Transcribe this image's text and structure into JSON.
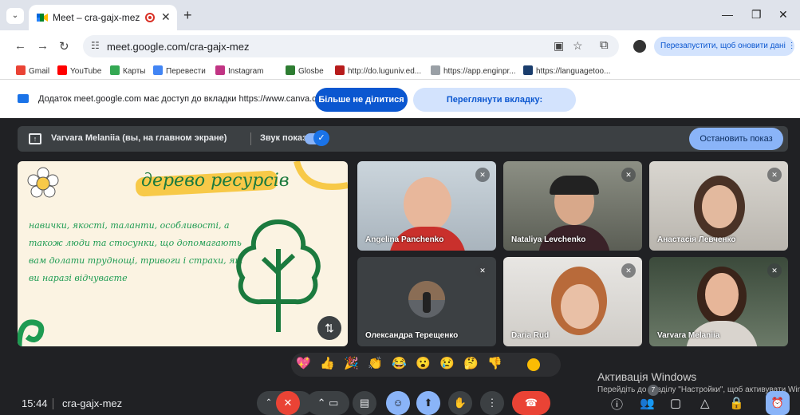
{
  "browser": {
    "tab_title": "Meet – cra-gajx-mez",
    "new_tab": "+",
    "url": "meet.google.com/cra-gajx-mez",
    "relaunch_label": "Перезапустити, щоб оновити дані",
    "bookmarks": [
      "Gmail",
      "YouTube",
      "Карты",
      "Перевести",
      "Instagram",
      "Glosbe",
      "http://do.luguniv.ed...",
      "https://app.enginpr...",
      "https://languagetoo..."
    ]
  },
  "infobar": {
    "text": "Додаток meet.google.com має доступ до вкладки https://www.canva.com",
    "stop_sharing": "Більше не ділитися",
    "view_tab": "Переглянути вкладку: www.canva.com"
  },
  "sharebar": {
    "presenter": "Varvara Melaniia (вы, на главном экране)",
    "sound_label": "Звук показа",
    "stop_button": "Остановить показ"
  },
  "slide": {
    "title": "дерево ресурсів",
    "text": "навички, якості, таланти, особливості, а також люди та стосунки, що допомагають вам долати труднощі, тривоги і страхи, які ви наразі відчуваєте"
  },
  "participants": [
    {
      "name": "Angelina Panchenko"
    },
    {
      "name": "Nataliya Levchenko"
    },
    {
      "name": "Анастасія Левченко"
    },
    {
      "name": "Олександра Терещенко"
    },
    {
      "name": "Daria Rud"
    },
    {
      "name": "Varvara Melaniia"
    }
  ],
  "reactions": [
    "💖",
    "👍",
    "🎉",
    "👏",
    "😂",
    "😮",
    "😢",
    "🤔",
    "👎"
  ],
  "footer": {
    "time": "15:44",
    "meeting_code": "cra-gajx-mez",
    "people_count": "7"
  },
  "windows_activation": {
    "title": "Активація Windows",
    "subtitle": "Перейдіть до розділу \"Настройки\", щоб активувати Windows."
  },
  "colors": {
    "meet_bg": "#202124",
    "accent_blue": "#0b57d0",
    "hangup_red": "#ea4335",
    "slide_green": "#1e9b52"
  }
}
